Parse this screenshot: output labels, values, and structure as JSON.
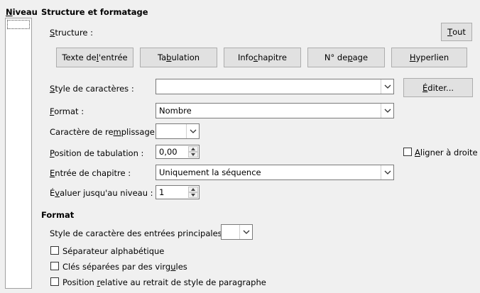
{
  "niveau": {
    "label_html": "<u>N</u>iveau"
  },
  "structure_section": {
    "title": "Structure et formatage",
    "structure_label_html": "<u>S</u>tructure :",
    "tout_button_html": "<u>T</u>out",
    "entry_buttons": [
      {
        "html": "Texte de <u>l</u>'entrée"
      },
      {
        "html": "Ta<u>b</u>ulation"
      },
      {
        "html": "Info <u>c</u>hapitre"
      },
      {
        "html": "N° de <u>p</u>age"
      },
      {
        "html": "<u>H</u>yperlien"
      }
    ],
    "char_style_label_html": "<u>S</u>tyle de caractères :",
    "char_style_value": "",
    "editer_button_html": "<u>É</u>diter...",
    "format_label_html": "<u>F</u>ormat :",
    "format_value": "Nombre",
    "fill_char_label_html": "Caractère de re<u>m</u>plissage :",
    "fill_char_value": "",
    "tab_position_label_html": "<u>P</u>osition de tabulation :",
    "tab_position_value": "0,00",
    "align_right_label_html": "<u>A</u>ligner à droite",
    "chapter_entry_label_html": "<u>E</u>ntrée de chapitre :",
    "chapter_entry_value": "Uniquement la séquence",
    "eval_level_label_html": "É<u>v</u>aluer jusqu'au niveau :",
    "eval_level_value": "1"
  },
  "format_section": {
    "title": "Format",
    "main_entries_label_html": "Style de caractère des entrées principales :",
    "main_entries_value": "",
    "checkboxes": [
      {
        "html": "Séparateur alphabétique",
        "checked": false
      },
      {
        "html": "Clés séparées par des virg<u>u</u>les",
        "checked": false
      },
      {
        "html": "Position <u>r</u>elative au retrait de style de paragraphe",
        "checked": false
      }
    ]
  },
  "icons": {
    "dropdown": "chevron-down-icon",
    "spin_up": "spin-up-icon",
    "spin_down": "spin-down-icon"
  }
}
